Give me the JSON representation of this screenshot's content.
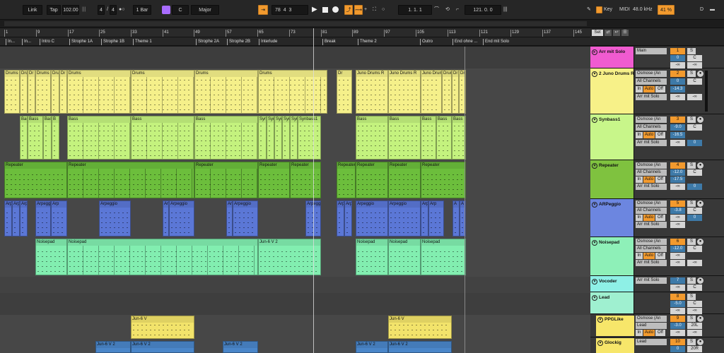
{
  "toolbar": {
    "link": "Link",
    "tap": "Tap",
    "tempo": "102.00",
    "sig_num": "4",
    "sig_den": "4",
    "quant": "1 Bar",
    "key_root": "C",
    "scale": "Major",
    "position": [
      "78",
      ".",
      "4",
      ".",
      "3"
    ],
    "loop_start": [
      "1",
      ".",
      "1",
      ".",
      "1"
    ],
    "loop_len": [
      "121",
      ".",
      "0",
      ".",
      "0"
    ],
    "key": "Key",
    "midi": "MIDI",
    "sample_rate": "48.0 kHz",
    "cpu": "41 %",
    "d_label": "D"
  },
  "ruler": {
    "bars": [
      "1",
      "9",
      "17",
      "25",
      "33",
      "41",
      "49",
      "57",
      "65",
      "73",
      "81",
      "89",
      "97",
      "105",
      "113",
      "121",
      "129",
      "137",
      "145"
    ]
  },
  "locators": [
    "In...",
    "In...",
    "Intro C",
    "Strophe 1A",
    "Strophe 1B",
    "Theme 1",
    "Strophe 2A",
    "Strophe 2B",
    "Interlude",
    "Break",
    "Theme 2",
    "Outro",
    "End ohne ...",
    "End mit Solo"
  ],
  "lanes": {
    "drums": {
      "clips": [
        "Drums",
        "Dru",
        "Dr",
        "Drums",
        "Dru",
        "Dr",
        "Drums",
        "Drums",
        "Drums",
        "Drums",
        "Dr",
        "Juno Drums R",
        "Juno Drums R",
        "Juno Drums R",
        "Drums R",
        "Dr",
        "Dr"
      ]
    },
    "bass": {
      "clips": [
        "Bas",
        "Bass",
        "Bas",
        "B",
        "Bass",
        "Bass",
        "Bass",
        "Syn",
        "Syn",
        "Syn",
        "Syn",
        "Syn",
        "Synbass1",
        "Bass",
        "Bass",
        "Bass",
        "Bass",
        "Bass"
      ]
    },
    "repeater": {
      "clips": [
        "Repeater",
        "Repeater",
        "Repeater",
        "Repeater",
        "Repeater",
        "Repeater",
        "Repeater",
        "Repeater",
        "Repeater"
      ]
    },
    "arpeggio": {
      "clips": [
        "Arp",
        "Arp",
        "Arp",
        "Arpeggio",
        "Arp",
        "Arpeggio",
        "Arc",
        "Arpeggio",
        "Arc",
        "Arpeggio",
        "Arpeggio",
        "Arp",
        "Arp",
        "Arpeggio",
        "Arpeggio",
        "Arp",
        "Arp",
        "A",
        "A"
      ]
    },
    "noisepad": {
      "clips": [
        "Noisepad",
        "Noisepad",
        "Jun-6 V 2",
        "Noisepad",
        "Noisepad",
        "Noisepad"
      ]
    },
    "ppglike": {
      "clips": [
        "Jun-6 V",
        "Jun-6 V"
      ]
    },
    "glockig": {
      "clips": [
        "Jun-6 V 2",
        "Jun-6 V 2",
        "Jun-6 V 2",
        "Jun-6 V 2",
        "Jun-6 V 2"
      ]
    }
  },
  "mixer": {
    "set": "Set",
    "tracks": [
      {
        "name": "Arr mit Solo",
        "color": "#f05bd0",
        "io": "Main",
        "num": "1",
        "solo": "S",
        "vol": "0",
        "pan": "C",
        "sendA": "-∞",
        "sendB": "-∞"
      },
      {
        "name": "2 Juno Drums R",
        "color": "#f7f188",
        "io": "Osmose (An",
        "chan": "All Channels",
        "mon_in": "In",
        "mon_auto": "Auto",
        "mon_off": "Off",
        "out": "Arr mit Solo",
        "num": "2",
        "solo": "S",
        "vol": "0",
        "volb": "-14.3",
        "pan": "C",
        "sendA": "-∞",
        "sendB": "-∞"
      },
      {
        "name": "Synbass1",
        "color": "#c8f68a",
        "io": "Osmose (An",
        "chan": "All Channels",
        "mon_in": "In",
        "mon_auto": "Auto",
        "mon_off": "Off",
        "out": "Arr mit Solo",
        "num": "3",
        "solo": "S",
        "vol": "-9.0",
        "volb": "-16.5",
        "pan": "C",
        "sendA": "-∞",
        "sendB": "0"
      },
      {
        "name": "Repeater",
        "color": "#7fc23f",
        "io": "Osmose (An",
        "chan": "All Channels",
        "mon_in": "In",
        "mon_auto": "Auto",
        "mon_off": "Off",
        "out": "Arr mit Solo",
        "num": "4",
        "solo": "S",
        "vol": "-12.0",
        "volb": "-17.5",
        "pan": "C",
        "sendA": "-∞",
        "sendB": "0"
      },
      {
        "name": "ARPeggio",
        "color": "#6c86e0",
        "io": "Osmose (An",
        "chan": "All Channels",
        "mon_in": "In",
        "mon_auto": "Auto",
        "mon_off": "Off",
        "out": "Arr mit Solo",
        "num": "5",
        "solo": "S",
        "vol": "-3.8",
        "volb": "-∞",
        "pan": "C",
        "sendA": "-∞",
        "sendB": "0"
      },
      {
        "name": "Noisepad",
        "color": "#8ef0b8",
        "io": "Osmose (An",
        "chan": "All Channels",
        "mon_in": "In",
        "mon_auto": "Auto",
        "mon_off": "Off",
        "out": "Arr mit Solo",
        "num": "6",
        "solo": "S",
        "vol": "-12.0",
        "volb": "-∞",
        "pan": "C",
        "sendA": "-∞",
        "sendB": "-∞"
      },
      {
        "name": "Vocoder",
        "color": "#8ef0e6",
        "io": "Arr mit Solo",
        "num": "7",
        "solo": "S",
        "vol": "-∞",
        "pan": "C",
        "sendA": "-∞",
        "sendB": "-∞"
      },
      {
        "name": "Lead",
        "color": "#9ff0d0",
        "io": "",
        "num": "8",
        "solo": "S",
        "vol": "-5.0",
        "pan": "C",
        "sendA": "-∞",
        "sendB": "-∞"
      },
      {
        "name": "PPGLike",
        "color": "#f7e66a",
        "io": "Osmose (An",
        "chan": "Lead",
        "mon_in": "In",
        "mon_auto": "Auto",
        "mon_off": "Off",
        "num": "9",
        "solo": "S",
        "vol": "-3.0",
        "pan": "20L",
        "sendA": "-∞",
        "sendB": "-∞"
      },
      {
        "name": "Glockig",
        "color": "#f7e66a",
        "io": "Lead",
        "num": "10",
        "solo": "S",
        "vol": "0",
        "pan": "20R",
        "sendA": "-∞",
        "sendB": "-∞"
      }
    ]
  },
  "colors": {
    "drums": "#f5f08a",
    "bass": "#c4f27e",
    "repeater": "#6cbe3c",
    "arpeggio": "#5b77d6",
    "noisepad": "#82eeb0",
    "ppglike": "#f2e36b",
    "glockig": "#4a86c9",
    "accent": "#f29a2e"
  }
}
